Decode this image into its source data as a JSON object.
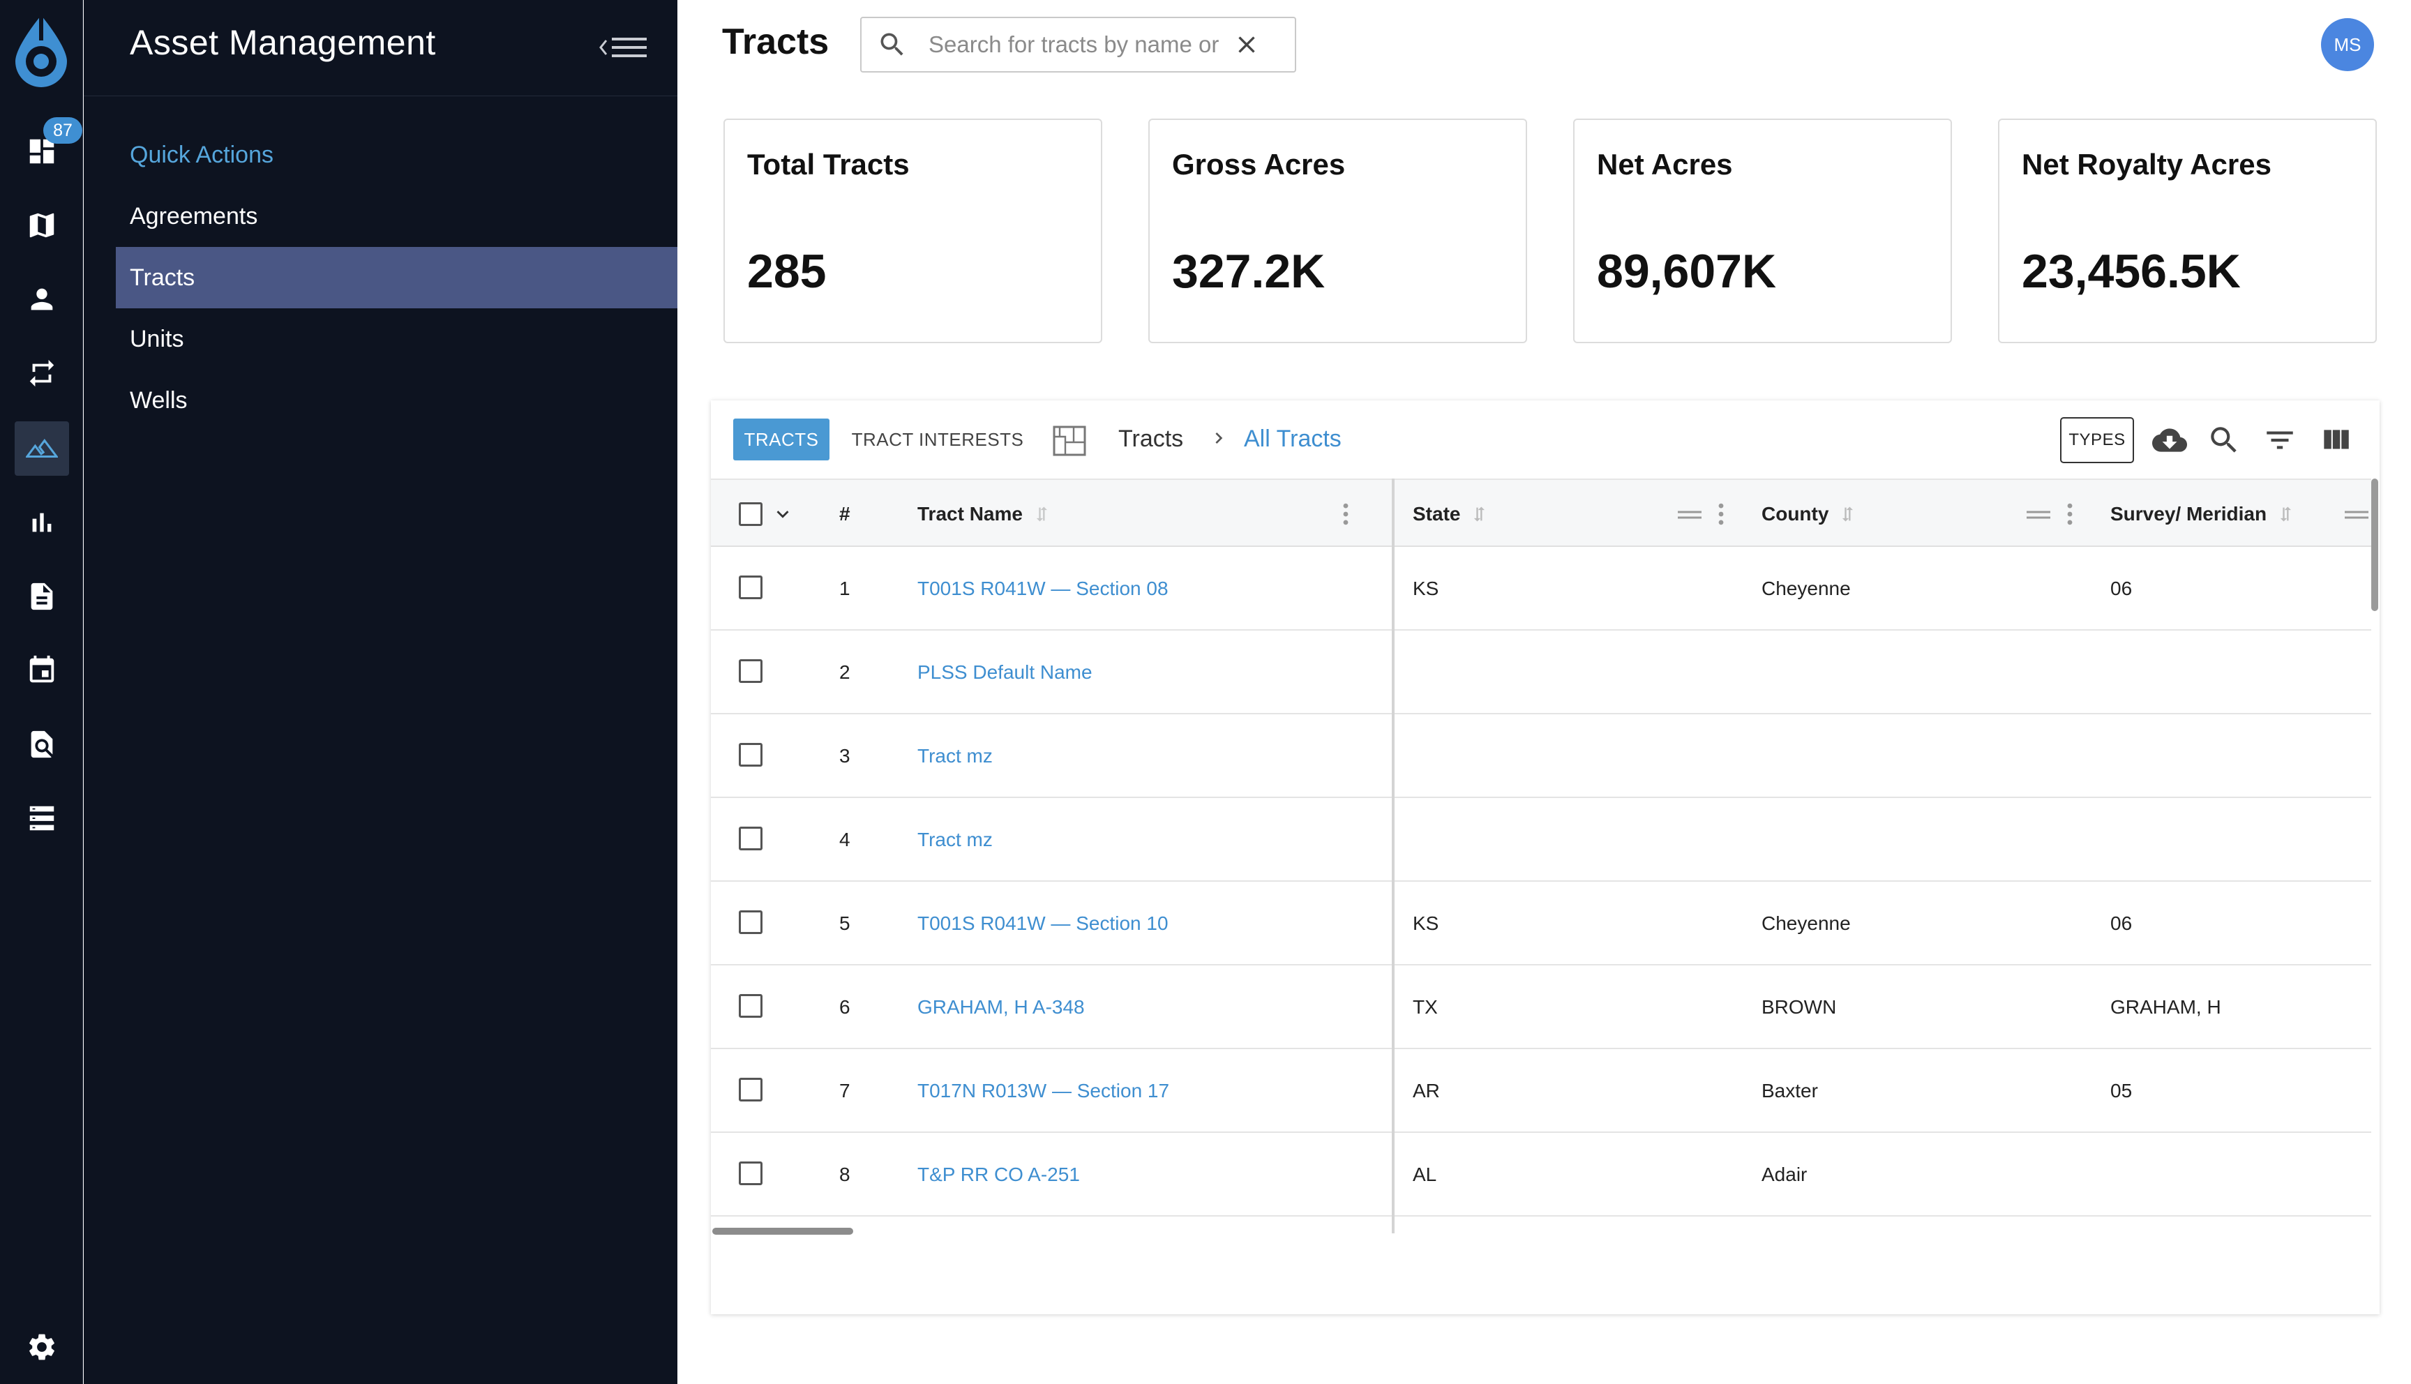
{
  "sidebar": {
    "title": "Asset Management",
    "badge": "87",
    "nav": [
      {
        "label": "Quick Actions"
      },
      {
        "label": "Agreements"
      },
      {
        "label": "Tracts"
      },
      {
        "label": "Units"
      },
      {
        "label": "Wells"
      }
    ]
  },
  "rail_icons": [
    "dashboard-icon",
    "map-icon",
    "person-icon",
    "repeat-icon",
    "landscape-icon",
    "bar-chart-icon",
    "document-icon",
    "calendar-icon",
    "document-search-icon",
    "list-icon",
    "settings-icon"
  ],
  "header": {
    "title": "Tracts",
    "search_placeholder": "Search for tracts by name or",
    "avatar": "MS"
  },
  "cards": [
    {
      "label": "Total Tracts",
      "value": "285"
    },
    {
      "label": "Gross Acres",
      "value": "327.2K"
    },
    {
      "label": "Net Acres",
      "value": "89,607K"
    },
    {
      "label": "Net Royalty Acres",
      "value": "23,456.5K"
    }
  ],
  "toolbar": {
    "tab_tracts": "TRACTS",
    "tab_interests": "TRACT INTERESTS",
    "crumb_root": "Tracts",
    "crumb_current": "All Tracts",
    "types_label": "TYPES"
  },
  "grid": {
    "columns": {
      "num": "#",
      "name": "Tract Name",
      "state": "State",
      "county": "County",
      "survey": "Survey/ Meridian"
    },
    "rows": [
      {
        "n": "1",
        "name": "T001S R041W — Section 08",
        "state": "KS",
        "county": "Cheyenne",
        "survey": "06"
      },
      {
        "n": "2",
        "name": "PLSS Default Name",
        "state": "",
        "county": "",
        "survey": ""
      },
      {
        "n": "3",
        "name": "Tract mz",
        "state": "",
        "county": "",
        "survey": ""
      },
      {
        "n": "4",
        "name": "Tract mz",
        "state": "",
        "county": "",
        "survey": ""
      },
      {
        "n": "5",
        "name": "T001S R041W — Section 10",
        "state": "KS",
        "county": "Cheyenne",
        "survey": "06"
      },
      {
        "n": "6",
        "name": "GRAHAM, H A-348",
        "state": "TX",
        "county": "BROWN",
        "survey": "GRAHAM, H"
      },
      {
        "n": "7",
        "name": "T017N R013W — Section 17",
        "state": "AR",
        "county": "Baxter",
        "survey": "05"
      },
      {
        "n": "8",
        "name": "T&P RR CO A-251",
        "state": "AL",
        "county": "Adair",
        "survey": ""
      }
    ]
  },
  "colors": {
    "accent": "#4a99d3",
    "link": "#3e8ed0",
    "sidebar_bg": "#0d1320",
    "active_nav": "#4a5785"
  }
}
